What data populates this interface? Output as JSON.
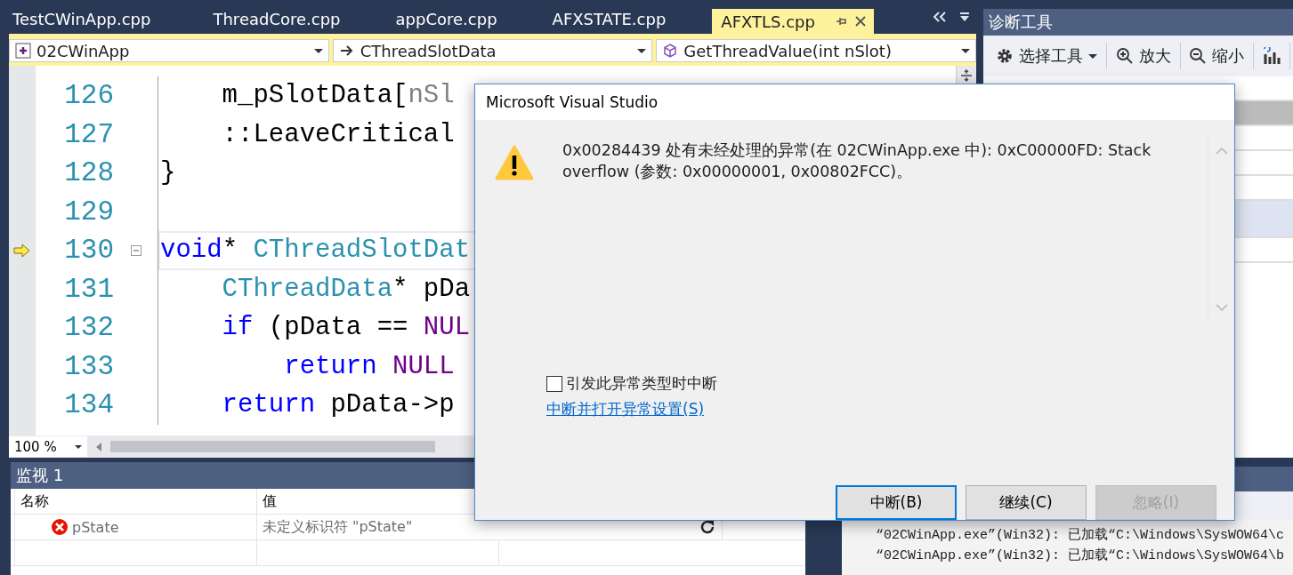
{
  "editor_tabs": [
    {
      "label": "TestCWinApp.cpp",
      "selected": false
    },
    {
      "label": "ThreadCore.cpp",
      "selected": false
    },
    {
      "label": "appCore.cpp",
      "selected": false
    },
    {
      "label": "AFXSTATE.cpp",
      "selected": false
    },
    {
      "label": "AFXTLS.cpp",
      "selected": true
    }
  ],
  "navigation": [
    {
      "kind": "project",
      "value": "02CWinApp"
    },
    {
      "kind": "class",
      "value": "CThreadSlotData"
    },
    {
      "kind": "method",
      "value": "GetThreadValue(int nSlot)"
    }
  ],
  "code_lines": [
    {
      "number": "126",
      "current_statement": false,
      "collapsible": false,
      "tokens": [
        {
          "kind": "plain",
          "t": "    m_pSlotData["
        },
        {
          "kind": "param",
          "t": "nSl"
        }
      ]
    },
    {
      "number": "127",
      "current_statement": false,
      "collapsible": false,
      "tokens": [
        {
          "kind": "plain",
          "t": "    ::LeaveCritical"
        }
      ]
    },
    {
      "number": "128",
      "current_statement": false,
      "collapsible": false,
      "tokens": [
        {
          "kind": "plain",
          "t": "}"
        }
      ]
    },
    {
      "number": "129",
      "current_statement": false,
      "collapsible": false
    },
    {
      "number": "130",
      "current_statement": true,
      "collapsible": true,
      "tokens": [
        {
          "kind": "keyword",
          "t": "void"
        },
        {
          "kind": "plain",
          "t": "* "
        },
        {
          "kind": "type",
          "t": "CThreadSlotDat"
        }
      ]
    },
    {
      "number": "131",
      "current_statement": false,
      "collapsible": false,
      "tokens": [
        {
          "kind": "type",
          "t": "    CThreadData"
        },
        {
          "kind": "plain",
          "t": "* pDa"
        }
      ]
    },
    {
      "number": "132",
      "current_statement": false,
      "collapsible": false,
      "tokens": [
        {
          "kind": "keyword",
          "t": "    if"
        },
        {
          "kind": "plain",
          "t": " (pData == "
        },
        {
          "kind": "macro",
          "t": "NUL"
        }
      ]
    },
    {
      "number": "133",
      "current_statement": false,
      "collapsible": false,
      "tokens": [
        {
          "kind": "keyword",
          "t": "        return"
        },
        {
          "kind": "macro",
          "t": " NULL"
        }
      ]
    },
    {
      "number": "134",
      "current_statement": false,
      "collapsible": false,
      "tokens": [
        {
          "kind": "keyword",
          "t": "    return"
        },
        {
          "kind": "plain",
          "t": " pData->p"
        }
      ]
    }
  ],
  "zoom": "100 %",
  "diagnostics": {
    "title": "诊断工具",
    "toolbar": [
      {
        "kind": "gear",
        "label": "选择工具",
        "dropdown": true
      },
      {
        "kind": "zoom-in",
        "label": "放大",
        "dropdown": false
      },
      {
        "kind": "zoom-out",
        "label": "缩小",
        "dropdown": false
      },
      {
        "kind": "chart",
        "dropdown": false
      }
    ]
  },
  "watch": {
    "title": "监视 1",
    "columns": [
      "名称",
      "值"
    ],
    "rows": [
      {
        "name": "pState",
        "value": "未定义标识符 \"pState\"",
        "error": true
      }
    ]
  },
  "output_lines": [
    "“02CWinApp.exe”(Win32): 已加载“C:\\Windows\\SysWOW64\\c",
    "“02CWinApp.exe”(Win32): 已加载“C:\\Windows\\SysWOW64\\b"
  ],
  "dialog": {
    "title": "Microsoft Visual Studio",
    "message": "0x00284439 处有未经处理的异常(在 02CWinApp.exe 中): 0xC00000FD: Stack overflow (参数: 0x00000001, 0x00802FCC)。",
    "checkbox": {
      "label": "引发此异常类型时中断",
      "checked": false
    },
    "link": "中断并打开异常设置(S)",
    "buttons": [
      {
        "label": "中断(B)",
        "default": true,
        "disabled": false
      },
      {
        "label": "继续(C)",
        "default": false,
        "disabled": false
      },
      {
        "label": "忽略(I)",
        "default": false,
        "disabled": true
      }
    ]
  }
}
